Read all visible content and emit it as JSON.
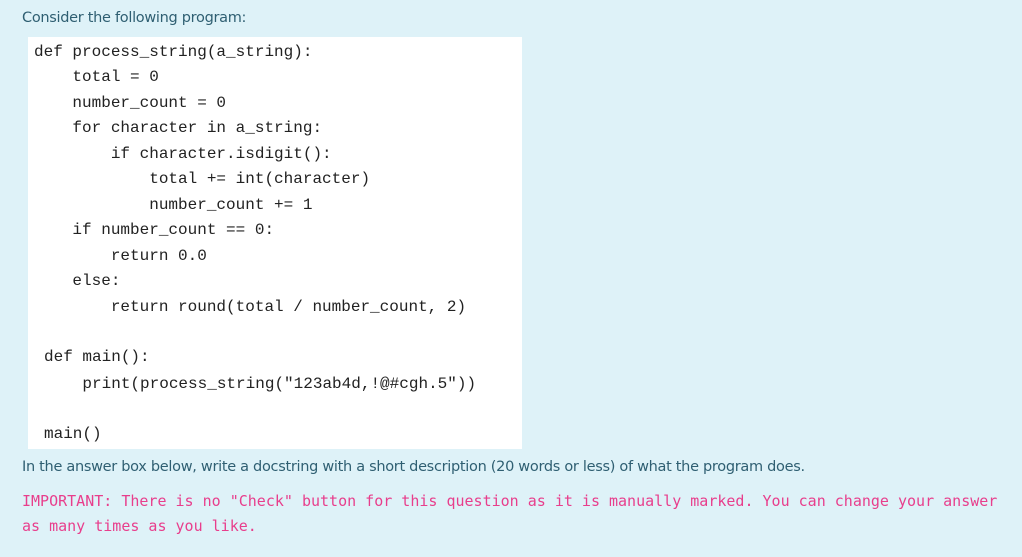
{
  "question": {
    "prompt": "Consider the following program:",
    "code_lines": [
      "def process_string(a_string):",
      "    total = 0",
      "    number_count = 0",
      "    for character in a_string:",
      "        if character.isdigit():",
      "            total += int(character)",
      "            number_count += 1",
      "    if number_count == 0:",
      "        return 0.0",
      "    else:",
      "        return round(total / number_count, 2)",
      "def main():",
      "    print(process_string(\"123ab4d,!@#cgh.5\"))",
      "main()"
    ],
    "instruction": "In the answer box below, write a docstring with a short description (20 words or less) of what the program does.",
    "important_note": "IMPORTANT: There is no \"Check\" button for this question as it is manually marked. You can change your answer as many times as you like."
  },
  "colors": {
    "background": "#def2f8",
    "code_background": "#ffffff",
    "text": "#2f5f72",
    "important": "#e83e8c"
  }
}
